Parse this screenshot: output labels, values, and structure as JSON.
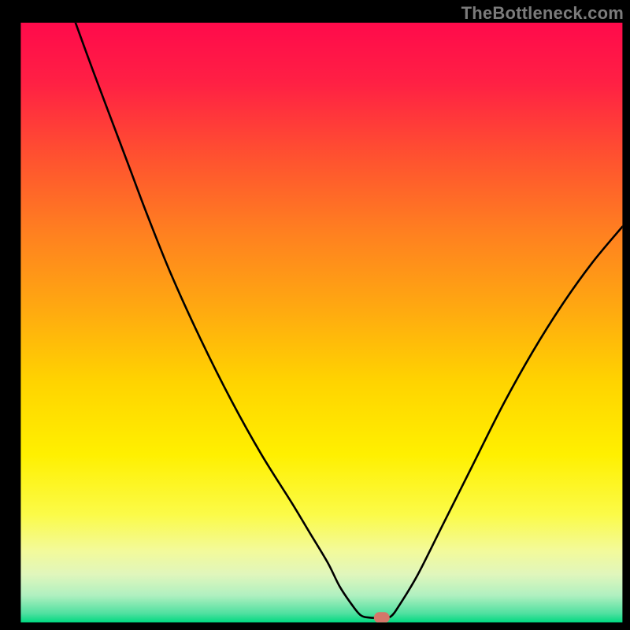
{
  "watermark": "TheBottleneck.com",
  "chart_data": {
    "type": "line",
    "title": "",
    "xlabel": "",
    "ylabel": "",
    "xlim": [
      0,
      100
    ],
    "ylim": [
      0,
      100
    ],
    "frame": {
      "xmin": 3.3,
      "ymin": 3.6,
      "xmax": 98.8,
      "ymax": 98.8
    },
    "curve_points": [
      {
        "x": 9.0,
        "y": 100.0
      },
      {
        "x": 12.0,
        "y": 92.0
      },
      {
        "x": 15.0,
        "y": 84.0
      },
      {
        "x": 18.0,
        "y": 76.0
      },
      {
        "x": 21.0,
        "y": 68.0
      },
      {
        "x": 25.0,
        "y": 58.0
      },
      {
        "x": 30.0,
        "y": 47.0
      },
      {
        "x": 35.0,
        "y": 37.0
      },
      {
        "x": 40.0,
        "y": 28.0
      },
      {
        "x": 45.0,
        "y": 20.0
      },
      {
        "x": 48.0,
        "y": 15.0
      },
      {
        "x": 51.0,
        "y": 10.0
      },
      {
        "x": 53.0,
        "y": 6.0
      },
      {
        "x": 55.0,
        "y": 3.0
      },
      {
        "x": 56.5,
        "y": 1.2
      },
      {
        "x": 58.0,
        "y": 0.8
      },
      {
        "x": 60.0,
        "y": 0.8
      },
      {
        "x": 61.5,
        "y": 1.0
      },
      {
        "x": 63.0,
        "y": 3.0
      },
      {
        "x": 66.0,
        "y": 8.0
      },
      {
        "x": 70.0,
        "y": 16.0
      },
      {
        "x": 75.0,
        "y": 26.0
      },
      {
        "x": 80.0,
        "y": 36.0
      },
      {
        "x": 85.0,
        "y": 45.0
      },
      {
        "x": 90.0,
        "y": 53.0
      },
      {
        "x": 95.0,
        "y": 60.0
      },
      {
        "x": 100.0,
        "y": 66.0
      }
    ],
    "marker": {
      "x": 60.0,
      "y": 0.8,
      "color": "#d4776a"
    },
    "gradient_stops": [
      {
        "offset": 0.0,
        "color": "#ff0a4b"
      },
      {
        "offset": 0.1,
        "color": "#ff2044"
      },
      {
        "offset": 0.22,
        "color": "#ff5030"
      },
      {
        "offset": 0.35,
        "color": "#ff8020"
      },
      {
        "offset": 0.48,
        "color": "#ffaa10"
      },
      {
        "offset": 0.6,
        "color": "#ffd400"
      },
      {
        "offset": 0.72,
        "color": "#fff000"
      },
      {
        "offset": 0.82,
        "color": "#fbfb48"
      },
      {
        "offset": 0.88,
        "color": "#f3fa9a"
      },
      {
        "offset": 0.92,
        "color": "#e0f6bc"
      },
      {
        "offset": 0.955,
        "color": "#b0f0c0"
      },
      {
        "offset": 0.985,
        "color": "#50e0a0"
      },
      {
        "offset": 1.0,
        "color": "#00d980"
      }
    ]
  }
}
